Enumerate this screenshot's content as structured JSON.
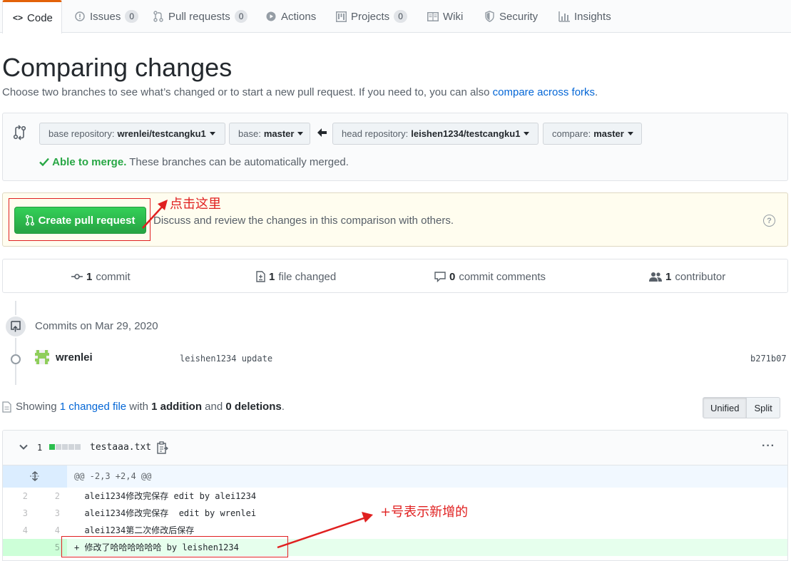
{
  "tabs": [
    {
      "label": "Code",
      "icon": "code-icon"
    },
    {
      "label": "Issues",
      "count": "0",
      "icon": "issue-icon"
    },
    {
      "label": "Pull requests",
      "count": "0",
      "icon": "pull-request-icon"
    },
    {
      "label": "Actions",
      "icon": "play-icon"
    },
    {
      "label": "Projects",
      "count": "0",
      "icon": "project-icon"
    },
    {
      "label": "Wiki",
      "icon": "book-icon"
    },
    {
      "label": "Security",
      "icon": "shield-icon"
    },
    {
      "label": "Insights",
      "icon": "graph-icon"
    }
  ],
  "page": {
    "title": "Comparing changes",
    "subtitle": "Choose two branches to see what’s changed or to start a new pull request. If you need to, you can also",
    "subtitle_link": "compare across forks",
    "subtitle_end": "."
  },
  "range": {
    "base_repo_label": "base repository:",
    "base_repo_value": "wrenlei/testcangku1",
    "base_label": "base:",
    "base_value": "master",
    "head_repo_label": "head repository:",
    "head_repo_value": "leishen1234/testcangku1",
    "compare_label": "compare:",
    "compare_value": "master",
    "merge_ok": "Able to merge.",
    "merge_text": "These branches can be automatically merged."
  },
  "pr": {
    "button_label": "Create pull request",
    "description": "Discuss and review the changes in this comparison with others.",
    "help_glyph": "?"
  },
  "annotations": {
    "click_here": "点击这里",
    "plus_means_new": "+号表示新增的"
  },
  "stats": {
    "commits_count": "1",
    "commits_label": "commit",
    "files_count": "1",
    "files_label": "file changed",
    "comments_count": "0",
    "comments_label": "commit comments",
    "contributors_count": "1",
    "contributors_label": "contributor"
  },
  "commits": {
    "date_label": "Commits on Mar 29, 2020",
    "author": "wrenlei",
    "message": "leishen1234 update",
    "sha": "b271b07"
  },
  "summary": {
    "prefix": "Showing",
    "changed_link": "1 changed file",
    "with": "with",
    "additions": "1 addition",
    "and": "and",
    "deletions": "0 deletions",
    "end": "."
  },
  "view_toggle": {
    "unified": "Unified",
    "split": "Split"
  },
  "file": {
    "diff_count": "1",
    "name": "testaaa.txt",
    "more": "···",
    "hunk_header": "@@ -2,3 +2,4 @@",
    "lines": [
      {
        "old": "2",
        "new": "2",
        "text": "  alei1234修改完保存 edit by alei1234"
      },
      {
        "old": "3",
        "new": "3",
        "text": "  alei1234修改完保存  edit by wrenlei"
      },
      {
        "old": "4",
        "new": "4",
        "text": "  alei1234第二次修改后保存"
      },
      {
        "old": "",
        "new": "5",
        "text": "+ 修改了哈哈哈哈哈哈 by leishen1234"
      }
    ]
  },
  "colors": {
    "accent": "#e36209",
    "link": "#0366d6",
    "green": "#28a745",
    "annotation_red": "#e02020"
  }
}
